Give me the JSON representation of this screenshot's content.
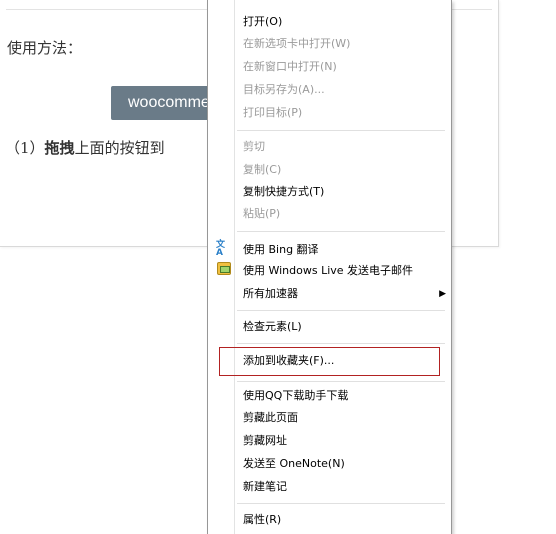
{
  "page": {
    "usage_label": "使用方法：",
    "plugin_button_label": "woocommerce",
    "instruction_prefix": "（1）",
    "instruction_bold": "拖拽",
    "instruction_rest": "上面的按钮到"
  },
  "context_menu": {
    "items": [
      {
        "label": "打开(O)",
        "disabled": false
      },
      {
        "label": "在新选项卡中打开(W)",
        "disabled": true
      },
      {
        "label": "在新窗口中打开(N)",
        "disabled": true
      },
      {
        "label": "目标另存为(A)...",
        "disabled": true
      },
      {
        "label": "打印目标(P)",
        "disabled": true
      },
      {
        "label": "剪切",
        "disabled": true
      },
      {
        "label": "复制(C)",
        "disabled": true
      },
      {
        "label": "复制快捷方式(T)",
        "disabled": false
      },
      {
        "label": "粘贴(P)",
        "disabled": true
      },
      {
        "label": "使用 Bing 翻译",
        "disabled": false,
        "icon": "translate-icon"
      },
      {
        "label": "使用 Windows Live 发送电子邮件",
        "disabled": false,
        "icon": "windows-live-mail-icon"
      },
      {
        "label": "所有加速器",
        "disabled": false,
        "submenu": true
      },
      {
        "label": "检查元素(L)",
        "disabled": false
      },
      {
        "label": "添加到收藏夹(F)...",
        "disabled": false,
        "highlighted": true
      },
      {
        "label": "使用QQ下载助手下载",
        "disabled": false
      },
      {
        "label": "剪藏此页面",
        "disabled": false
      },
      {
        "label": "剪藏网址",
        "disabled": false
      },
      {
        "label": "发送至 OneNote(N)",
        "disabled": false
      },
      {
        "label": "新建笔记",
        "disabled": false
      },
      {
        "label": "属性(R)",
        "disabled": false
      }
    ]
  },
  "colors": {
    "highlight_border": "#b22222",
    "plugin_button_bg": "#6a7b88",
    "disabled_text": "#9a9a9a"
  }
}
